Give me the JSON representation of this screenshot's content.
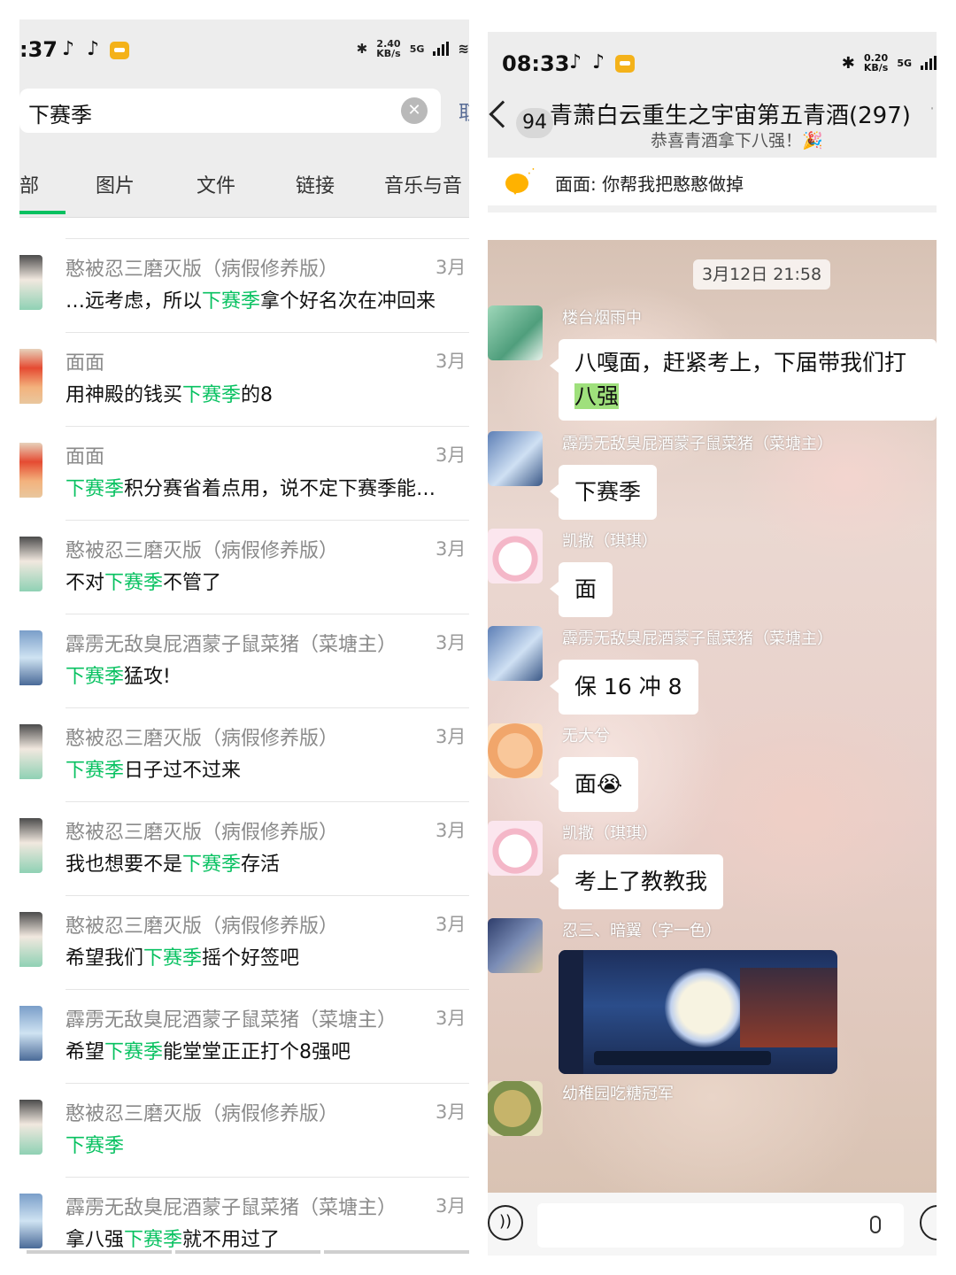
{
  "left": {
    "status": {
      "time": ":37",
      "net_speed_value": "2.40",
      "net_speed_unit": "KB/s",
      "network": "5G"
    },
    "search": {
      "query": "下赛季",
      "cancel": "取"
    },
    "tabs": [
      "部",
      "图片",
      "文件",
      "链接",
      "音乐与音"
    ],
    "results": [
      {
        "name": "憨被忍三磨灭版（病假修养版）",
        "date": "3月",
        "pre": "…远考虑，所以",
        "hl": "下赛季",
        "post": "拿个好名次在冲回来"
      },
      {
        "name": "面面",
        "date": "3月",
        "pre": "用神殿的钱买",
        "hl": "下赛季",
        "post": "的8"
      },
      {
        "name": "面面",
        "date": "3月",
        "pre": "",
        "hl": "下赛季",
        "post": "积分赛省着点用，说不定下赛季能…"
      },
      {
        "name": "憨被忍三磨灭版（病假修养版）",
        "date": "3月",
        "pre": "不对",
        "hl": "下赛季",
        "post": "不管了"
      },
      {
        "name": "霹雳无敌臭屁酒蒙子鼠菜猪（菜塘主）",
        "date": "3月",
        "pre": "",
        "hl": "下赛季",
        "post": "猛攻!"
      },
      {
        "name": "憨被忍三磨灭版（病假修养版）",
        "date": "3月",
        "pre": "",
        "hl": "下赛季",
        "post": "日子过不过来"
      },
      {
        "name": "憨被忍三磨灭版（病假修养版）",
        "date": "3月",
        "pre": "我也想要不是",
        "hl": "下赛季",
        "post": "存活"
      },
      {
        "name": "憨被忍三磨灭版（病假修养版）",
        "date": "3月",
        "pre": "希望我们",
        "hl": "下赛季",
        "post": "摇个好签吧"
      },
      {
        "name": "霹雳无敌臭屁酒蒙子鼠菜猪（菜塘主）",
        "date": "3月",
        "pre": "希望",
        "hl": "下赛季",
        "post": "能堂堂正正打个8强吧"
      },
      {
        "name": "憨被忍三磨灭版（病假修养版）",
        "date": "3月",
        "pre": "",
        "hl": "下赛季",
        "post": ""
      },
      {
        "name": "霹雳无敌臭屁酒蒙子鼠菜猪（菜塘主）",
        "date": "3月",
        "pre": "拿八强",
        "hl": "下赛季",
        "post": "就不用过了"
      }
    ]
  },
  "right": {
    "status": {
      "time": "08:33",
      "net_speed_value": "0.20",
      "net_speed_unit": "KB/s",
      "network": "5G"
    },
    "header": {
      "unread": "94",
      "group_name": "青萧白云重生之宇宙第五青酒(297)",
      "subtitle": "恭喜青酒拿下八强！🎉"
    },
    "notice": "面面: 你帮我把憨憨做掉",
    "timestamp": "3月12日 21:58",
    "messages": [
      {
        "sender": "楼台烟雨中",
        "text": "八嘎面，赶紧考上，下届带我们打",
        "hl": "八强"
      },
      {
        "sender": "霹雳无敌臭屁酒蒙子鼠菜猪（菜塘主）",
        "text": "下赛季"
      },
      {
        "sender": "凯撒（琪琪）",
        "text": "面"
      },
      {
        "sender": "霹雳无敌臭屁酒蒙子鼠菜猪（菜塘主）",
        "text": "保 16 冲 8"
      },
      {
        "sender": "无大兮",
        "text": "面😭"
      },
      {
        "sender": "凯撒（琪琪）",
        "text": "考上了教教我"
      },
      {
        "sender": "忍三、暗翼（字一色）",
        "image": "game-screenshot"
      },
      {
        "sender": "幼稚园吃糖冠军"
      }
    ]
  },
  "colors": {
    "accent": "#07c160",
    "bubble_highlight": "#9fe07c"
  }
}
